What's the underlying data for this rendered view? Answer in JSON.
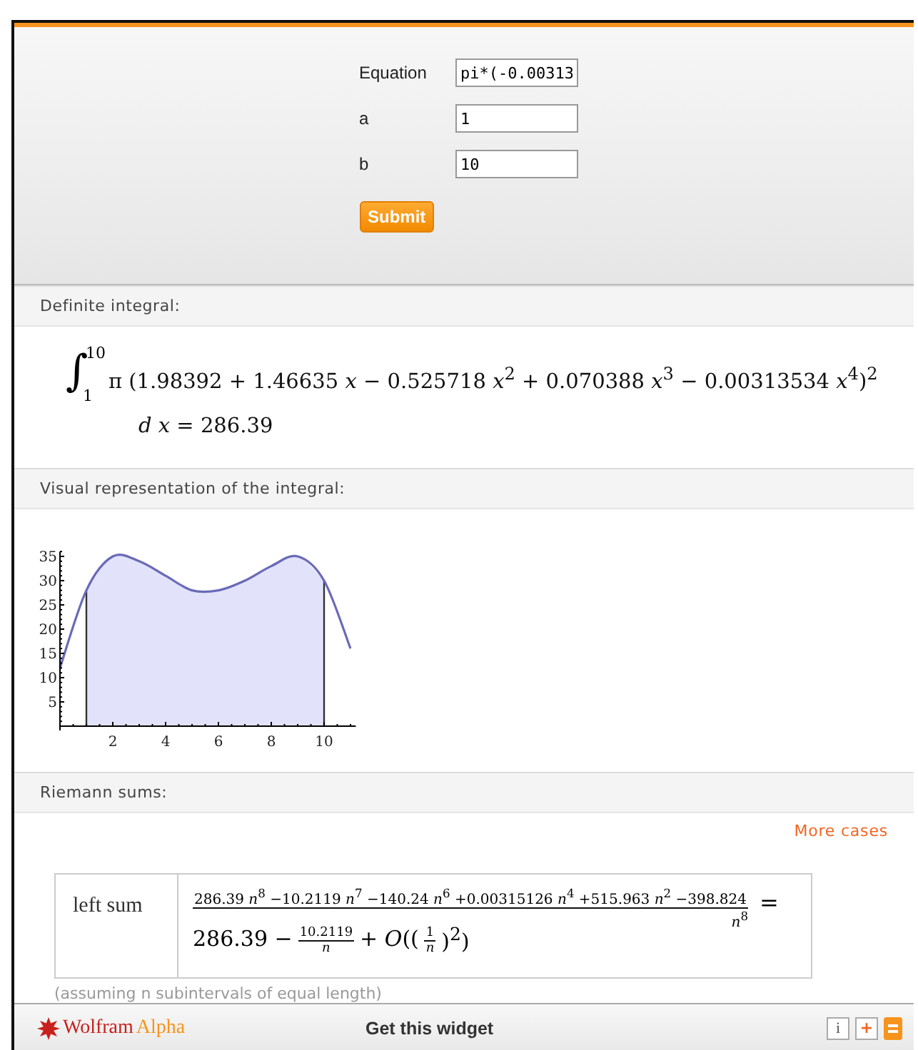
{
  "form": {
    "fields": [
      {
        "label": "Equation",
        "value": "pi*(-0.00313"
      },
      {
        "label": "a",
        "value": "1"
      },
      {
        "label": "b",
        "value": "10"
      }
    ],
    "submit": "Submit"
  },
  "definite_integral": {
    "title": "Definite integral:",
    "symbol": "∫",
    "upper": "10",
    "lower": "1",
    "integrand": "π (1.98392 + 1.46635 *x* − 0.525718 *x*$^{2}$ + 0.070388 *x*$^{3}$ − 0.00313534 *x*$^{4}$)$^{2}$",
    "result": "*d x* = 286.39"
  },
  "visual": {
    "title": "Visual representation of the integral:",
    "chart_data": {
      "type": "line",
      "x": [
        0,
        1,
        2,
        3,
        4,
        5,
        6,
        7,
        8,
        9,
        10,
        11
      ],
      "series": [
        {
          "type": "line",
          "color": "#6a6ab8",
          "values": [
            12,
            28,
            35,
            34,
            31,
            28,
            28,
            30,
            33,
            35,
            30,
            16
          ]
        },
        {
          "type": "area",
          "color": "#e2e2fb",
          "values": [
            null,
            28,
            35,
            34,
            31,
            28,
            28,
            30,
            33,
            35,
            30,
            null
          ]
        }
      ],
      "xlim": [
        0,
        11.2
      ],
      "ylim": [
        0,
        36
      ],
      "xticks": [
        2,
        4,
        6,
        8,
        10
      ],
      "yticks": [
        5,
        10,
        15,
        20,
        25,
        30,
        35
      ],
      "ref_lines": [
        {
          "axis": "x",
          "value": 1
        },
        {
          "axis": "x",
          "value": 10
        }
      ]
    }
  },
  "riemann": {
    "title": "Riemann sums:",
    "more_cases": "More cases",
    "row_label": "left sum",
    "numerator": "286.39 *n*$^{8}$ −10.2119 *n*$^{7}$ −140.24 *n*$^{6}$ +0.00315126 *n*$^{4}$ +515.963 *n*$^{2}$ −398.824",
    "denominator": "*n*$^{8}$",
    "equals": "=",
    "leading": "286.39 −",
    "frac_num": "10.2119",
    "frac_den": "n",
    "big_o": "+ *O*((",
    "inner_num": "1",
    "inner_den": "n",
    "closing": ")$^{2}$)",
    "note": "(assuming n subintervals of equal length)"
  },
  "footer": {
    "brand_main": "Wolfram",
    "brand_accent": "Alpha",
    "link": "Get this widget",
    "buttons": [
      "i",
      "+"
    ]
  }
}
